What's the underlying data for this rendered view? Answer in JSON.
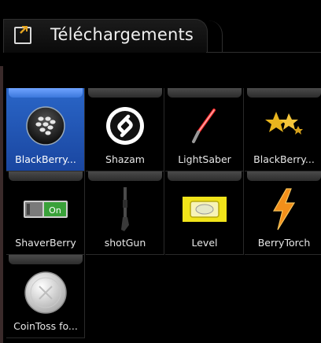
{
  "header": {
    "title": "Téléchargements",
    "icon": "folder-download-icon"
  },
  "apps": [
    {
      "label": "BlackBerry...",
      "icon": "blackberry-logo-icon",
      "selected": true
    },
    {
      "label": "Shazam",
      "icon": "shazam-icon",
      "selected": false
    },
    {
      "label": "LightSaber",
      "icon": "lightsaber-icon",
      "selected": false
    },
    {
      "label": "BlackBerry...",
      "icon": "blackberry-stars-icon",
      "selected": false
    },
    {
      "label": "ShaverBerry",
      "icon": "shaver-toggle-icon",
      "selected": false,
      "icon_text": "On"
    },
    {
      "label": "shotGun",
      "icon": "shotgun-icon",
      "selected": false
    },
    {
      "label": "Level",
      "icon": "bubble-level-icon",
      "selected": false
    },
    {
      "label": "BerryTorch",
      "icon": "lightning-bolt-icon",
      "selected": false
    },
    {
      "label": "CoinToss fo...",
      "icon": "coin-icon",
      "selected": false
    }
  ],
  "colors": {
    "selection": "#2a66c8",
    "background": "#000000"
  }
}
